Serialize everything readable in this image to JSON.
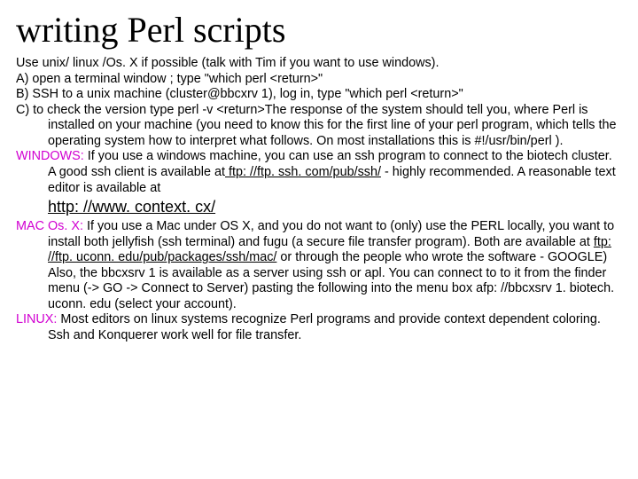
{
  "title": "writing Perl scripts",
  "intro": "Use unix/ linux /Os. X if possible (talk with Tim if you want to use windows).",
  "a": "A) open a terminal window ; type \"which perl <return>\"",
  "b": "B) SSH to a unix machine (cluster@bbcxrv 1), log in, type \"which perl <return>\"",
  "c": "C) to check the version type perl -v <return>The response of the system should tell you, where Perl is installed on your machine (you need to know this for the first line of your perl program, which tells the operating system how to interpret what follows. On most installations this is #!/usr/bin/perl ).",
  "win_label": "WINDOWS:",
  "win_text1": " If you use a windows machine, you can use an ssh program to connect to the biotech cluster. A good ssh client is available at",
  "win_link1": " ftp: //ftp. ssh. com/pub/ssh/",
  "win_text2": " - highly recommended. A reasonable text editor is available at",
  "win_biglink": "http: //www. context. cx/",
  "mac_label": "MAC Os. X:",
  "mac_text1": " If you use a Mac under OS X, and you do not want to (only) use the PERL locally, you want to install both jellyfish (ssh terminal) and fugu (a secure file transfer program). Both are available at ",
  "mac_link": "ftp: //ftp. uconn. edu/pub/packages/ssh/mac/",
  "mac_text2": " or through the people who wrote the software - GOOGLE)  Also, the bbcxsrv 1 is available as a server using ssh or apl. You can connect to to it from the finder menu (-> GO -> Connect to Server) pasting the following into the menu box  afp: //bbcxsrv 1. biotech. uconn. edu (select your account).",
  "linux_label": "LINUX:",
  "linux_text": " Most editors on linux systems recognize Perl programs and provide context dependent coloring. Ssh and Konquerer work well for file transfer."
}
